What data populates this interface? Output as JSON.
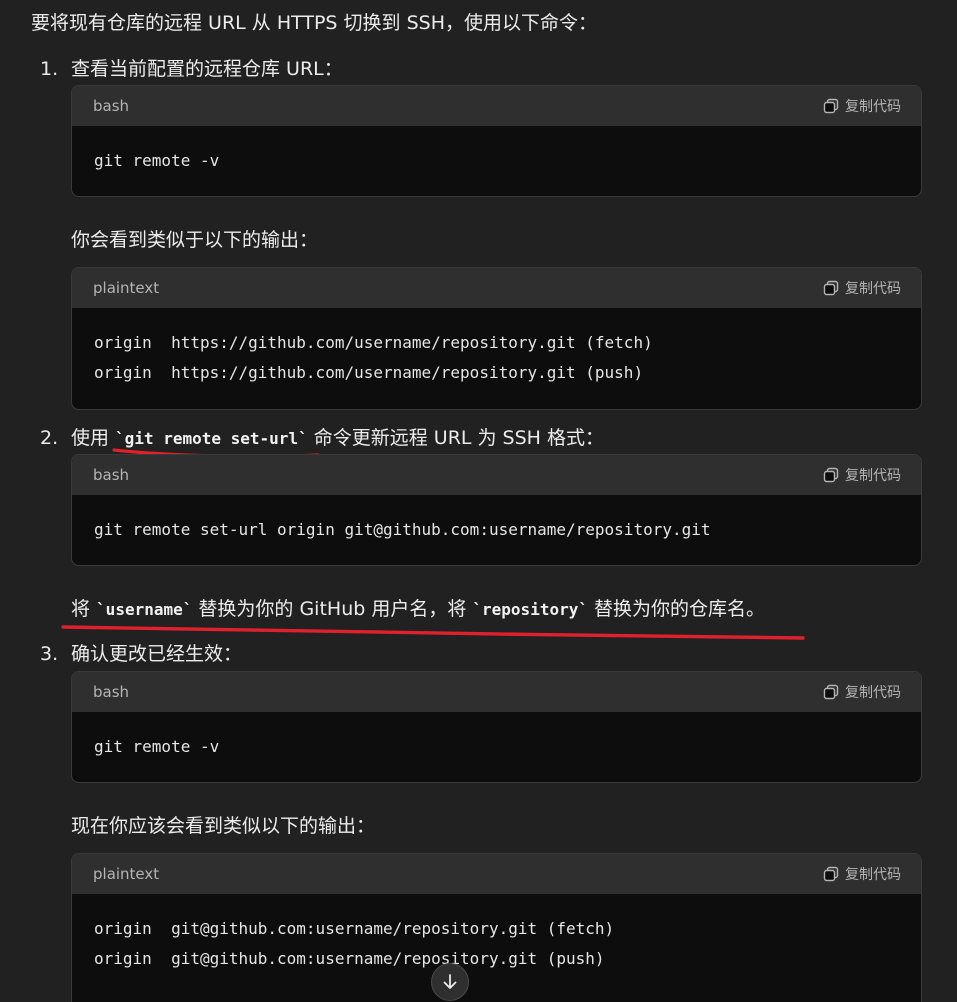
{
  "intro": "要将现有仓库的远程 URL 从 HTTPS 切换到 SSH，使用以下命令：",
  "copy_label": "复制代码",
  "steps": [
    {
      "num": "1.",
      "text": "查看当前配置的远程仓库 URL："
    },
    {
      "num": "2.",
      "text_before": "使用 ",
      "code": "`git remote set-url`",
      "text_after": " 命令更新远程 URL 为 SSH 格式："
    },
    {
      "num": "3.",
      "text": "确认更改已经生效："
    }
  ],
  "notes": {
    "output_intro_1": "你会看到类似于以下的输出：",
    "replace_part1": "将 ",
    "replace_code1": "`username`",
    "replace_part2": " 替换为你的 GitHub 用户名，将 ",
    "replace_code2": "`repository`",
    "replace_part3": " 替换为你的仓库名。",
    "output_intro_2": "现在你应该会看到类似以下的输出："
  },
  "code_blocks": [
    {
      "lang": "bash",
      "lines": [
        "git remote -v"
      ]
    },
    {
      "lang": "plaintext",
      "lines": [
        "origin  https://github.com/username/repository.git (fetch)",
        "origin  https://github.com/username/repository.git (push)"
      ]
    },
    {
      "lang": "bash",
      "lines": [
        "git remote set-url origin git@github.com:username/repository.git"
      ]
    },
    {
      "lang": "bash",
      "lines": [
        "git remote -v"
      ]
    },
    {
      "lang": "plaintext",
      "lines": [
        "origin  git@github.com:username/repository.git (fetch)",
        "origin  git@github.com:username/repository.git (push)"
      ]
    }
  ],
  "annotation_color": "#e0202c"
}
